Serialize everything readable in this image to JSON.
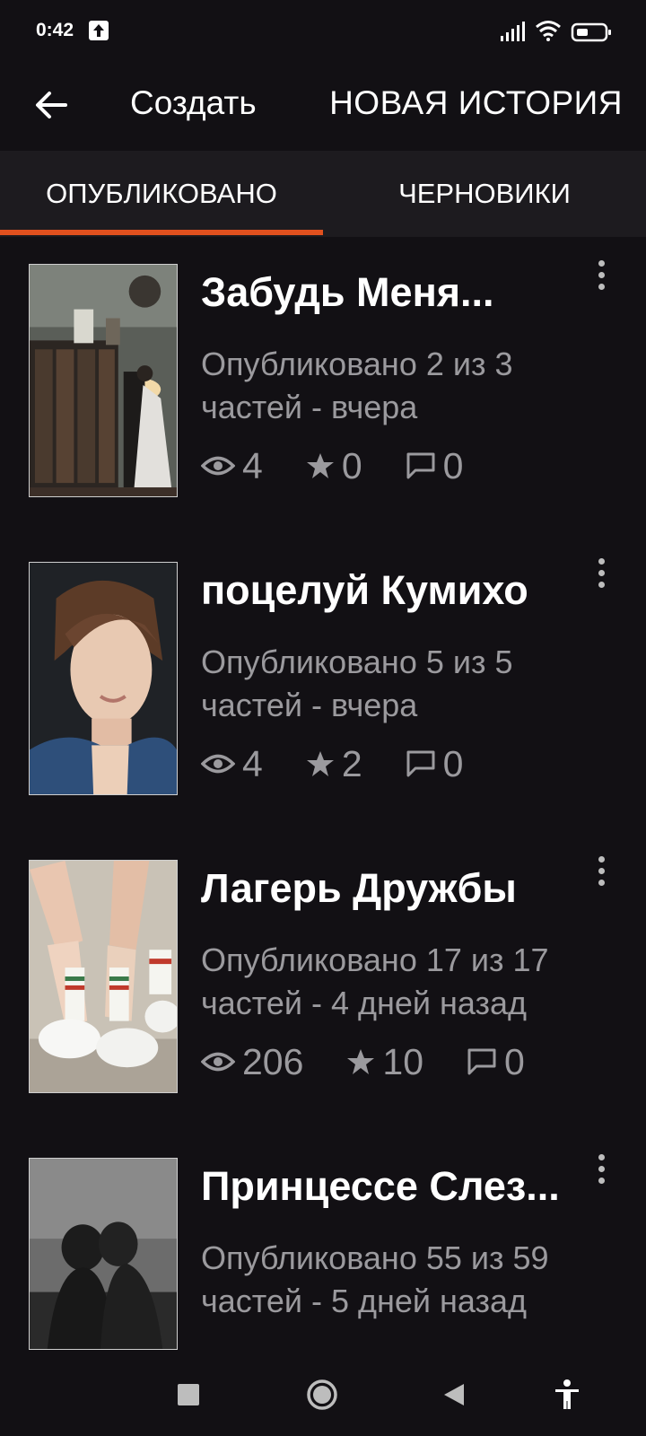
{
  "status_bar": {
    "time": "0:42"
  },
  "app_bar": {
    "create_label": "Создать",
    "new_story_label": "НОВАЯ ИСТОРИЯ"
  },
  "tabs": [
    {
      "label": "ОПУБЛИКОВАНО",
      "selected": true
    },
    {
      "label": "ЧЕРНОВИКИ",
      "selected": false
    }
  ],
  "stories": [
    {
      "title": "Забудь Меня...",
      "meta_line1": "Опубликовано 2 из 3",
      "meta_line2": "частей - вчера",
      "views": "4",
      "votes": "0",
      "comments": "0"
    },
    {
      "title": "поцелуй Кумихо",
      "meta_line1": "Опубликовано 5 из 5",
      "meta_line2": "частей - вчера",
      "views": "4",
      "votes": "2",
      "comments": "0"
    },
    {
      "title": "Лагерь Дружбы",
      "meta_line1": "Опубликовано 17 из 17",
      "meta_line2": "частей - 4 дней назад",
      "views": "206",
      "votes": "10",
      "comments": "0"
    },
    {
      "title": "Принцессе Слез...",
      "meta_line1": "Опубликовано 55 из 59",
      "meta_line2": "частей - 5 дней назад",
      "views": "",
      "votes": "",
      "comments": ""
    }
  ],
  "colors": {
    "background": "#121014",
    "tab_bar": "#1d1b1f",
    "accent": "#e0501e",
    "secondary_text": "#9b9a9e"
  }
}
